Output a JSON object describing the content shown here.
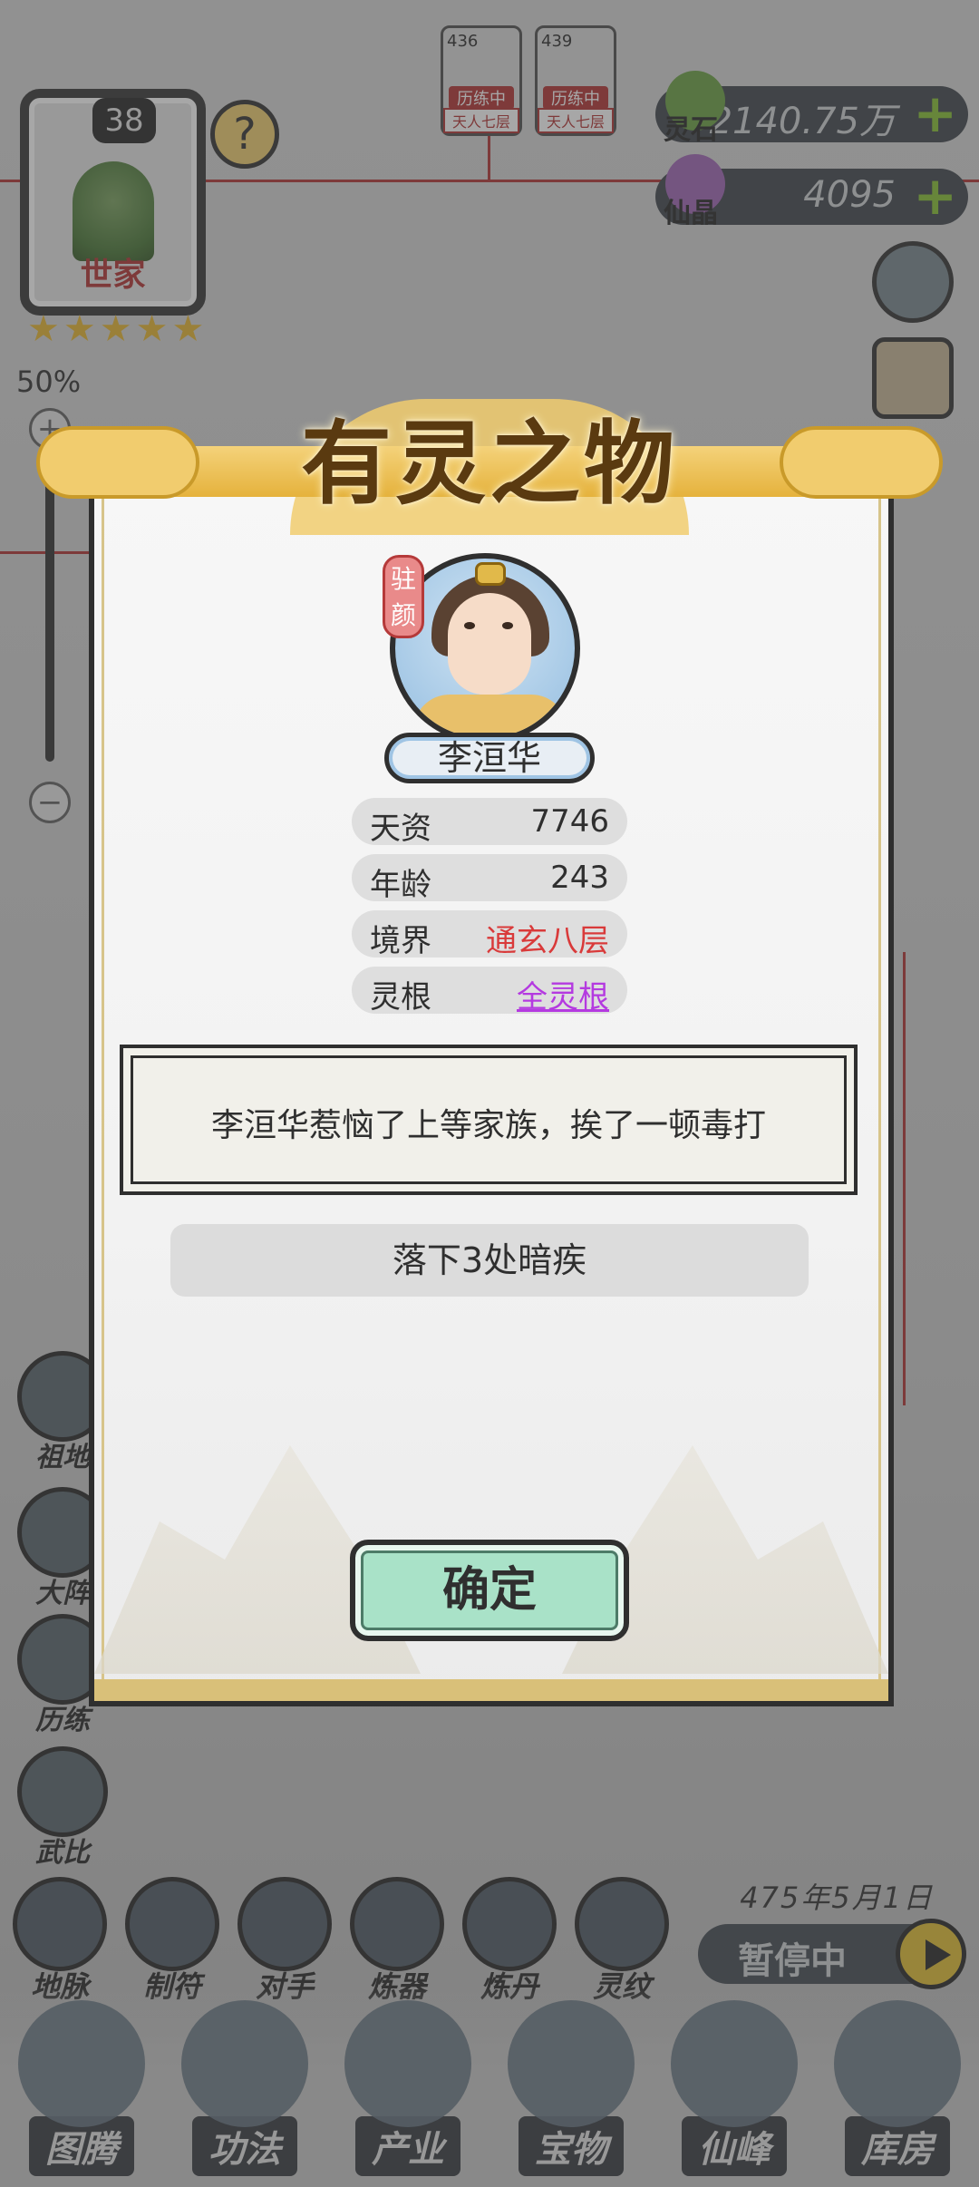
{
  "clan": {
    "level": "38",
    "name": "世家",
    "stars": 5
  },
  "map_zoom": {
    "percent": "50%",
    "plus": "+",
    "minus": "−"
  },
  "currencies": [
    {
      "label": "灵石",
      "value": "2140.75万",
      "plus": "+"
    },
    {
      "label": "仙晶",
      "value": "4095",
      "plus": "+"
    }
  ],
  "top_characters": [
    {
      "level": "436",
      "status": "历练中",
      "realm": "天人七层"
    },
    {
      "level": "439",
      "status": "历练中",
      "realm": "天人七层"
    }
  ],
  "left_menu": [
    {
      "label": "祖地"
    },
    {
      "label": "大阵"
    },
    {
      "label": "历练"
    },
    {
      "label": "武比"
    }
  ],
  "sub_nav": [
    {
      "label": "地脉"
    },
    {
      "label": "制符"
    },
    {
      "label": "对手"
    },
    {
      "label": "炼器"
    },
    {
      "label": "炼丹"
    },
    {
      "label": "灵纹"
    }
  ],
  "game_time": {
    "date": "475年5月1日",
    "pause_label": "暂停中"
  },
  "main_nav": [
    {
      "label": "图腾"
    },
    {
      "label": "功法"
    },
    {
      "label": "产业"
    },
    {
      "label": "宝物"
    },
    {
      "label": "仙峰"
    },
    {
      "label": "库房"
    }
  ],
  "popup": {
    "title": "有灵之物",
    "tag": "驻颜",
    "name": "李洹华",
    "stats": [
      {
        "label": "天资",
        "value": "7746"
      },
      {
        "label": "年龄",
        "value": "243"
      },
      {
        "label": "境界",
        "value": "通玄八层"
      },
      {
        "label": "灵根",
        "value": "全灵根"
      }
    ],
    "event_text": "李洹华惹恼了上等家族，挨了一顿毒打",
    "result_text": "落下3处暗疾",
    "confirm_label": "确定"
  },
  "colors": {
    "realm_red": "#d93a3a",
    "root_purple": "#b43ae0",
    "confirm_green": "#a9e2c8",
    "banner_gold": "#f1cc6e"
  }
}
